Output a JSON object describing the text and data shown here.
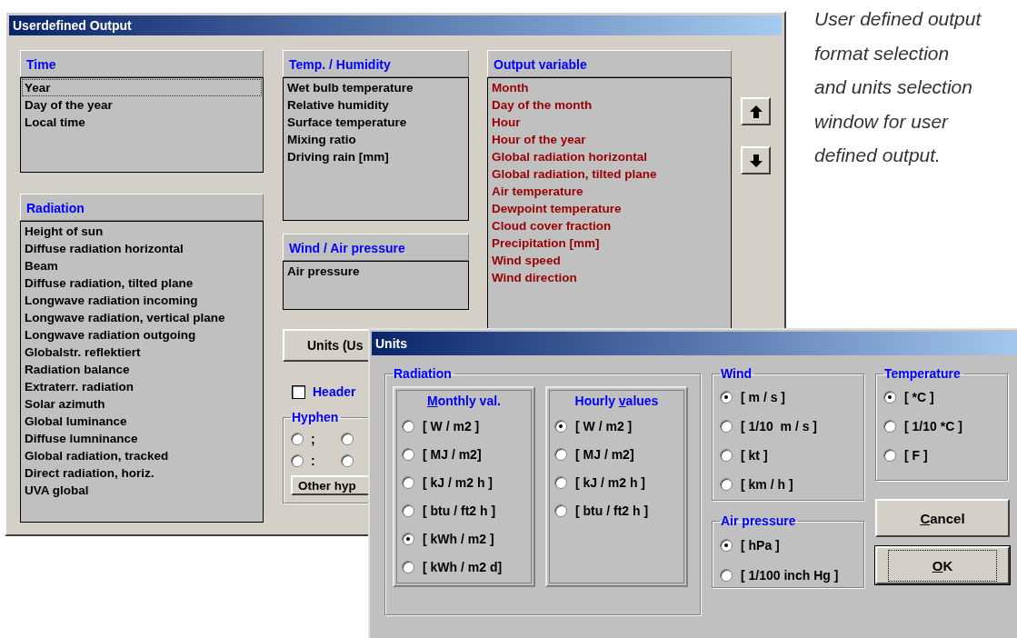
{
  "main_window": {
    "title": "Userdefined Output",
    "time_list": {
      "heading": "Time",
      "items": [
        {
          "label": "Year",
          "focused": true
        },
        {
          "label": "Day of the year",
          "focused": false
        },
        {
          "label": "Local time",
          "focused": false
        }
      ]
    },
    "radiation_list": {
      "heading": "Radiation",
      "items": [
        {
          "label": "Height of sun",
          "focused": false
        },
        {
          "label": "Diffuse radiation horizontal",
          "focused": false
        },
        {
          "label": "Beam",
          "focused": false
        },
        {
          "label": "Diffuse radiation, tilted plane",
          "focused": false
        },
        {
          "label": "Longwave radiation incoming",
          "focused": false
        },
        {
          "label": "Longwave radiation, vertical plane",
          "focused": false
        },
        {
          "label": "Longwave radiation outgoing",
          "focused": false
        },
        {
          "label": "Globalstr. reflektiert",
          "focused": false
        },
        {
          "label": "Radiation balance",
          "focused": false
        },
        {
          "label": "Extraterr. radiation",
          "focused": false
        },
        {
          "label": "Solar azimuth",
          "focused": false
        },
        {
          "label": "Global luminance",
          "focused": false
        },
        {
          "label": "Diffuse lumninance",
          "focused": false
        },
        {
          "label": "Global radiation, tracked",
          "focused": false
        },
        {
          "label": "Direct radiation, horiz.",
          "focused": false
        },
        {
          "label": "UVA global",
          "focused": false
        }
      ]
    },
    "temp_list": {
      "heading": "Temp. / Humidity",
      "items": [
        {
          "label": "Wet bulb temperature",
          "focused": false
        },
        {
          "label": "Relative humidity",
          "focused": false
        },
        {
          "label": "Surface temperature",
          "focused": false
        },
        {
          "label": "Mixing ratio",
          "focused": false
        },
        {
          "label": "Driving rain [mm]",
          "focused": false
        }
      ]
    },
    "wind_list": {
      "heading": "Wind / Air pressure",
      "items": [
        {
          "label": "Air pressure",
          "focused": false
        }
      ]
    },
    "output_list": {
      "heading": "Output variable",
      "items": [
        {
          "label": "Month",
          "focused": false
        },
        {
          "label": "Day of the month",
          "focused": false
        },
        {
          "label": "Hour",
          "focused": false
        },
        {
          "label": "Hour of the year",
          "focused": false
        },
        {
          "label": "Global radiation horizontal",
          "focused": false
        },
        {
          "label": "Global radiation, tilted plane",
          "focused": false
        },
        {
          "label": "Air temperature",
          "focused": false
        },
        {
          "label": "Dewpoint temperature",
          "focused": false
        },
        {
          "label": "Cloud cover fraction",
          "focused": false
        },
        {
          "label": "Precipitation [mm]",
          "focused": false
        },
        {
          "label": "Wind speed",
          "focused": false
        },
        {
          "label": "Wind direction",
          "focused": false
        }
      ]
    },
    "units_button": "Units (Us",
    "header_checkbox": {
      "label": "Header",
      "checked": false
    },
    "hyphen": {
      "title": "Hyphen",
      "options": [
        {
          "label": ";",
          "selected": false
        },
        {
          "selected": false
        },
        {
          "label": ":",
          "selected": false
        },
        {
          "selected": false
        }
      ]
    },
    "other_button": "Other hyp"
  },
  "units_dialog": {
    "title": "Units",
    "radiation": {
      "title": "Radiation",
      "columns": [
        {
          "title_key": "M",
          "title_after": "onthly val.",
          "options": [
            {
              "label": "[ W / m2 ]",
              "selected": false
            },
            {
              "label": "[ MJ / m2]",
              "selected": false
            },
            {
              "label": "[ kJ / m2 h ]",
              "selected": false
            },
            {
              "label": "[ btu / ft2 h ]",
              "selected": false
            },
            {
              "label": "[ kWh / m2 ]",
              "selected": true
            },
            {
              "label": "[ kWh / m2 d]",
              "selected": false
            }
          ]
        },
        {
          "title_before": "Hourly ",
          "title_key": "v",
          "title_after": "alues",
          "options": [
            {
              "label": "[ W / m2 ]",
              "selected": true
            },
            {
              "label": "[ MJ / m2]",
              "selected": false
            },
            {
              "label": "[ kJ / m2 h ]",
              "selected": false
            },
            {
              "label": "[ btu / ft2 h ]",
              "selected": false
            }
          ]
        }
      ]
    },
    "wind": {
      "title": "Wind",
      "options": [
        {
          "label": "[ m / s ]",
          "selected": true
        },
        {
          "label": "[ 1/10  m / s ]",
          "selected": false
        },
        {
          "label": "[ kt ]",
          "selected": false
        },
        {
          "label": "[ km / h ]",
          "selected": false
        }
      ]
    },
    "air_pressure": {
      "title": "Air pressure",
      "options": [
        {
          "label": "[ hPa ]",
          "selected": true
        },
        {
          "label": "[ 1/100 inch Hg ]",
          "selected": false
        }
      ]
    },
    "temperature": {
      "title": "Temperature",
      "options": [
        {
          "label": "[ *C ]",
          "selected": true
        },
        {
          "label": "[ 1/10 *C ]",
          "selected": false
        },
        {
          "label": "[ F ]",
          "selected": false
        }
      ]
    },
    "buttons": [
      {
        "label_key": "C",
        "label_after": "ancel",
        "default": false
      },
      {
        "label_key": "O",
        "label_after": "K",
        "default": true
      }
    ]
  },
  "caption": "User defined output format selection and units selection window for user defined output."
}
